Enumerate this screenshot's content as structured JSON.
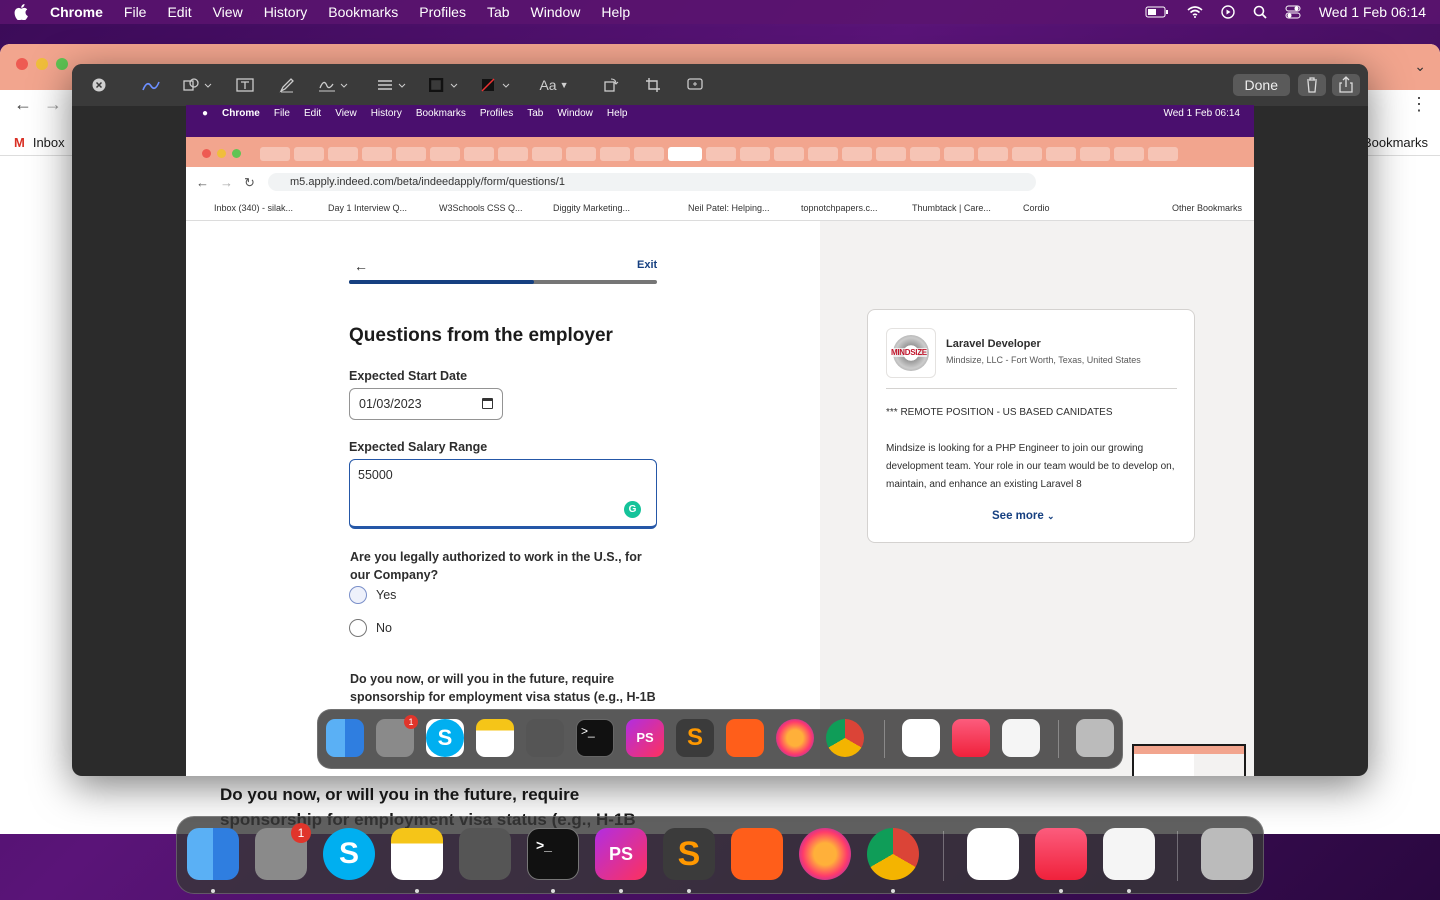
{
  "menubar": {
    "app": "Chrome",
    "items": [
      "File",
      "Edit",
      "View",
      "History",
      "Bookmarks",
      "Profiles",
      "Tab",
      "Window",
      "Help"
    ],
    "datetime": "Wed 1 Feb  06:14"
  },
  "bg_browser": {
    "bookmark_inbox": "Inbox",
    "bookmarks_label": "Bookmarks",
    "lower_text": "Do you now, or will you in the future, require sponsorship for employment visa status (e.g., H-1B"
  },
  "preview_toolbar": {
    "done": "Done",
    "font_label": "Aa"
  },
  "inner": {
    "menubar": {
      "app": "Chrome",
      "items": [
        "File",
        "Edit",
        "View",
        "History",
        "Bookmarks",
        "Profiles",
        "Tab",
        "Window",
        "Help"
      ],
      "datetime": "Wed 1 Feb  06:14"
    },
    "url": "m5.apply.indeed.com/beta/indeedapply/form/questions/1",
    "bookmarks": [
      "Inbox (340) - silak...",
      "Day 1 Interview Q...",
      "W3Schools CSS Q...",
      "Diggity Marketing...",
      "Neil Patel: Helping...",
      "topnotchpapers.c...",
      "Thumbtack | Care...",
      "Cordio",
      "Other Bookmarks"
    ]
  },
  "form": {
    "exit": "Exit",
    "progress": 0.6,
    "heading": "Questions from the employer",
    "start_date_label": "Expected Start Date",
    "start_date_value": "01/03/2023",
    "salary_label": "Expected Salary Range",
    "salary_value": "55000",
    "auth_question": "Are you legally authorized to work in the U.S., for our Company?",
    "option_yes": "Yes",
    "option_no": "No",
    "sponsor_question": "Do you now, or will you in the future, require sponsorship for employment visa status (e.g., H-1B"
  },
  "job": {
    "logo_text": "MINDSIZE",
    "title": "Laravel Developer",
    "company": "Mindsize, LLC - Fort Worth, Texas, United States",
    "line1": "*** REMOTE POSITION - US BASED CANIDATES",
    "line2": "Mindsize is looking for a PHP Engineer to join our growing development team. Your role in our team would be to develop on, maintain, and enhance an existing Laravel 8",
    "see_more": "See more"
  },
  "dock": {
    "settings_badge": "1",
    "phpstorm_label": "PS"
  }
}
